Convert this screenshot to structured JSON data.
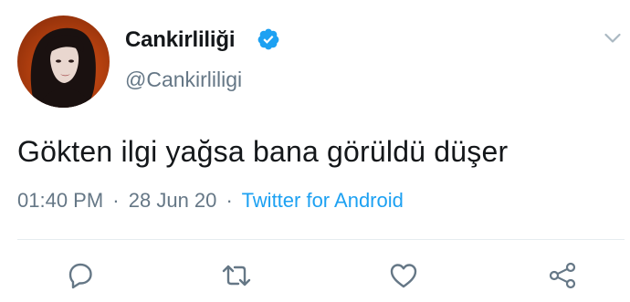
{
  "tweet": {
    "display_name": "Cankirliliği",
    "handle": "@Cankirliligi",
    "verified": true,
    "text": "Gökten ilgi yağsa bana görüldü düşer",
    "time": "01:40 PM",
    "date": "28 Jun 20",
    "separator": "·",
    "source": "Twitter for Android"
  },
  "actions": {
    "reply_icon": "reply-icon",
    "retweet_icon": "retweet-icon",
    "like_icon": "like-icon",
    "share_icon": "share-icon"
  },
  "colors": {
    "text_primary": "#14171a",
    "text_secondary": "#657786",
    "accent": "#1da1f2",
    "divider": "#e6ecf0",
    "avatar_bg": "#c14a14"
  }
}
